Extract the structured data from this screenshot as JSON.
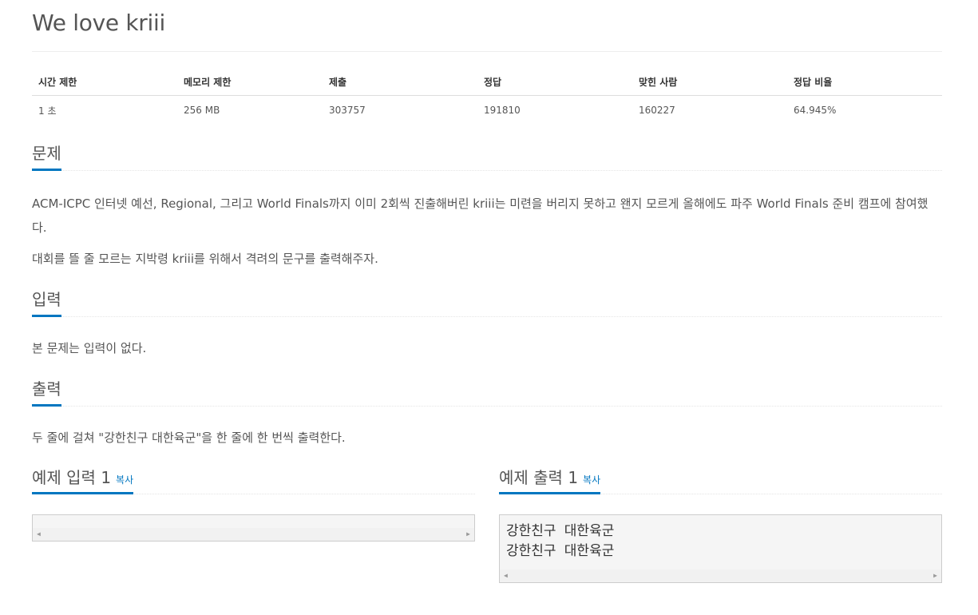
{
  "title": "We love kriii",
  "info": {
    "headers": [
      "시간 제한",
      "메모리 제한",
      "제출",
      "정답",
      "맞힌 사람",
      "정답 비율"
    ],
    "values": [
      "1 초",
      "256 MB",
      "303757",
      "191810",
      "160227",
      "64.945%"
    ]
  },
  "problem": {
    "heading": "문제",
    "paragraph1": "ACM-ICPC 인터넷 예선, Regional, 그리고 World Finals까지 이미 2회씩 진출해버린 kriii는 미련을 버리지 못하고 왠지 모르게 올해에도 파주 World Finals 준비 캠프에 참여했다.",
    "paragraph2": "대회를 뜰 줄 모르는 지박령 kriii를 위해서 격려의 문구를 출력해주자."
  },
  "input": {
    "heading": "입력",
    "text": "본 문제는 입력이 없다."
  },
  "output": {
    "heading": "출력",
    "text": "두 줄에 걸쳐 \"강한친구 대한육군\"을 한 줄에 한 번씩 출력한다."
  },
  "sample_input": {
    "heading": "예제 입력 1",
    "copy_label": "복사",
    "content": ""
  },
  "sample_output": {
    "heading": "예제 출력 1",
    "copy_label": "복사",
    "content": "강한친구 대한육군\n강한친구 대한육군"
  },
  "colors": {
    "accent": "#0076c0",
    "text": "#555555",
    "box_bg": "#f5f5f5"
  },
  "icons": {
    "scroll_left": "scroll-left-arrow-icon",
    "scroll_right": "scroll-right-arrow-icon"
  }
}
